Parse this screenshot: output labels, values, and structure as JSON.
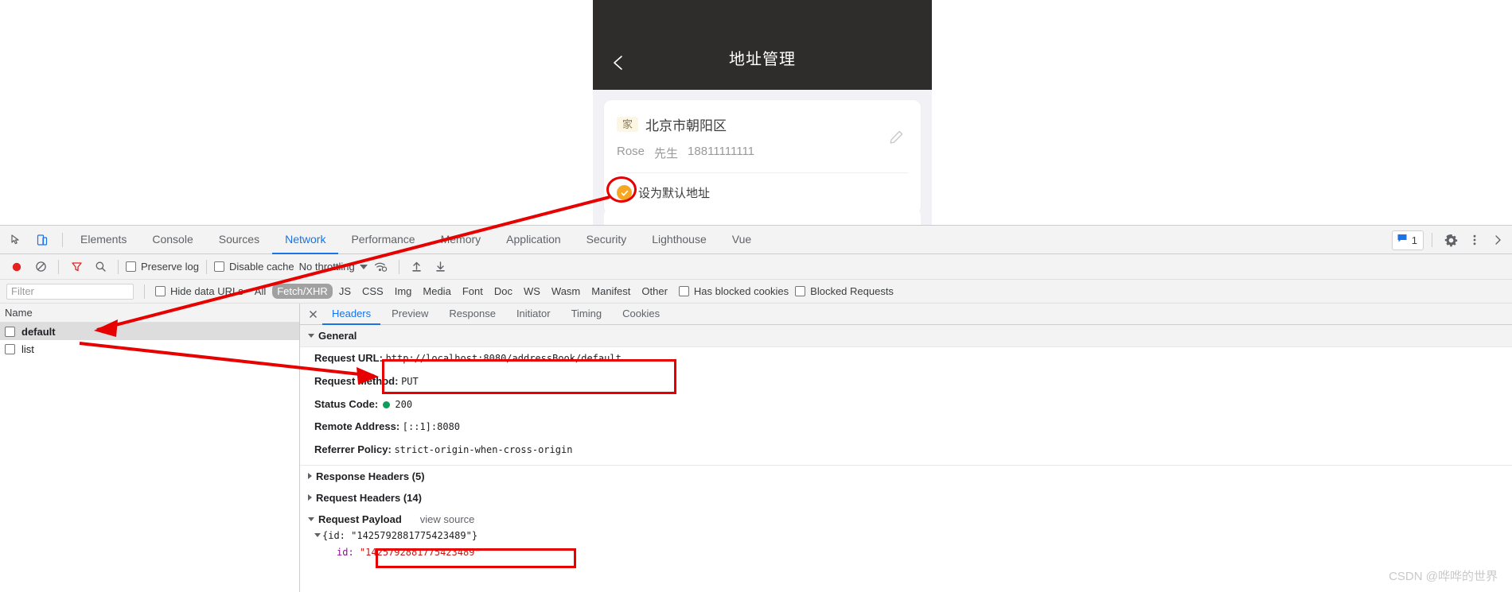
{
  "mobile": {
    "header": {
      "title": "地址管理",
      "back_icon": "chevron-left-icon"
    },
    "address_card": {
      "tag": "家",
      "address": "北京市朝阳区",
      "contact_name": "Rose",
      "honorific": "先生",
      "phone": "18811111111",
      "edit_icon": "pencil-icon",
      "default_checkbox": {
        "label": "设为默认地址",
        "checked": true,
        "color": "#f5a623"
      }
    }
  },
  "devtools": {
    "toolbar_icons": [
      "inspect-element-icon",
      "device-toolbar-icon"
    ],
    "panels": [
      {
        "label": "Elements",
        "active": false
      },
      {
        "label": "Console",
        "active": false
      },
      {
        "label": "Sources",
        "active": false
      },
      {
        "label": "Network",
        "active": true
      },
      {
        "label": "Performance",
        "active": false
      },
      {
        "label": "Memory",
        "active": false
      },
      {
        "label": "Application",
        "active": false
      },
      {
        "label": "Security",
        "active": false
      },
      {
        "label": "Lighthouse",
        "active": false
      },
      {
        "label": "Vue",
        "active": false
      }
    ],
    "right_controls": {
      "message_count": "1",
      "message_icon": "message-icon",
      "settings_icon": "gear-icon",
      "more_icon": "more-vertical-icon",
      "close_icon": "close-icon"
    },
    "network_toolbar": {
      "record_icon": "record-icon",
      "clear_icon": "clear-icon",
      "filter_icon": "filter-icon",
      "search_icon": "search-icon",
      "preserve_log": "Preserve log",
      "disable_cache": "Disable cache",
      "throttling": "No throttling",
      "wifi_icon": "network-conditions-icon",
      "import_icon": "import-har-icon",
      "export_icon": "export-har-icon"
    },
    "filter_bar": {
      "filter_placeholder": "Filter",
      "hide_data_urls": "Hide data URLs",
      "types": [
        {
          "label": "All",
          "selected": false
        },
        {
          "label": "Fetch/XHR",
          "selected": true
        },
        {
          "label": "JS",
          "selected": false
        },
        {
          "label": "CSS",
          "selected": false
        },
        {
          "label": "Img",
          "selected": false
        },
        {
          "label": "Media",
          "selected": false
        },
        {
          "label": "Font",
          "selected": false
        },
        {
          "label": "Doc",
          "selected": false
        },
        {
          "label": "WS",
          "selected": false
        },
        {
          "label": "Wasm",
          "selected": false
        },
        {
          "label": "Manifest",
          "selected": false
        },
        {
          "label": "Other",
          "selected": false
        }
      ],
      "has_blocked_cookies": "Has blocked cookies",
      "blocked_requests": "Blocked Requests"
    },
    "request_list": {
      "column_header": "Name",
      "rows": [
        {
          "name": "default",
          "selected": true
        },
        {
          "name": "list",
          "selected": false
        }
      ]
    },
    "detail_tabs": [
      {
        "label": "Headers",
        "active": true
      },
      {
        "label": "Preview",
        "active": false
      },
      {
        "label": "Response",
        "active": false
      },
      {
        "label": "Initiator",
        "active": false
      },
      {
        "label": "Timing",
        "active": false
      },
      {
        "label": "Cookies",
        "active": false
      }
    ],
    "general": {
      "section_title": "General",
      "request_url_label": "Request URL:",
      "request_url_value": "http://localhost:8080/addressBook/default",
      "request_method_label": "Request Method:",
      "request_method_value": "PUT",
      "status_code_label": "Status Code:",
      "status_code_value": "200",
      "remote_address_label": "Remote Address:",
      "remote_address_value": "[::1]:8080",
      "referrer_policy_label": "Referrer Policy:",
      "referrer_policy_value": "strict-origin-when-cross-origin"
    },
    "sections": {
      "response_headers": "Response Headers (5)",
      "request_headers": "Request Headers (14)",
      "request_payload": "Request Payload",
      "view_source": "view source"
    },
    "payload": {
      "collapsed_line": "{id: \"1425792881775423489\"}",
      "key": "id:",
      "value": "\"1425792881775423489\""
    }
  },
  "watermark": "CSDN @哗哗的世界",
  "colors": {
    "accent": "#1a73e8",
    "annotation_red": "#e60000",
    "default_orange": "#f5a623",
    "status_green": "#0f9d58"
  }
}
